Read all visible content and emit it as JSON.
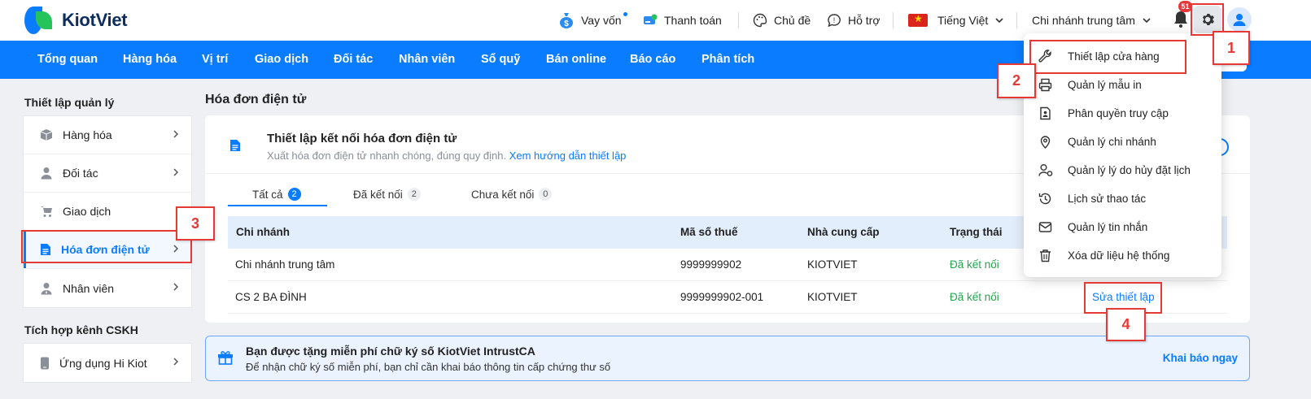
{
  "brand": {
    "name": "KiotViet"
  },
  "topbar": {
    "loan": "Vay vốn",
    "payment": "Thanh toán",
    "theme": "Chủ đề",
    "support": "Hỗ trợ",
    "language": "Tiếng Việt",
    "branch": "Chi nhánh trung tâm",
    "notification_count": "51"
  },
  "nav": [
    "Tổng quan",
    "Hàng hóa",
    "Vị trí",
    "Giao dịch",
    "Đối tác",
    "Nhân viên",
    "Sổ quỹ",
    "Bán online",
    "Báo cáo",
    "Phân tích"
  ],
  "sidebar": {
    "section1_title": "Thiết lập quản lý",
    "items": [
      {
        "label": "Hàng hóa"
      },
      {
        "label": "Đối tác"
      },
      {
        "label": "Giao dịch"
      },
      {
        "label": "Hóa đơn điện tử"
      },
      {
        "label": "Nhân viên"
      }
    ],
    "section2_title": "Tích hợp kênh CSKH",
    "items2": [
      {
        "label": "Ứng dụng Hi Kiot"
      }
    ]
  },
  "main": {
    "page_title": "Hóa đơn điện tử",
    "connect_title": "Thiết lập kết nối hóa đơn điện tử",
    "connect_desc": "Xuất hóa đơn điện tử nhanh chóng, đúng quy định.",
    "connect_link": "Xem hướng dẫn thiết lập",
    "tabs": [
      {
        "label": "Tất cả",
        "count": "2"
      },
      {
        "label": "Đã kết nối",
        "count": "2"
      },
      {
        "label": "Chưa kết nối",
        "count": "0"
      }
    ],
    "columns": [
      "Chi nhánh",
      "Mã số thuế",
      "Nhà cung cấp",
      "Trạng thái"
    ],
    "rows": [
      {
        "branch": "Chi nhánh trung tâm",
        "tax": "9999999902",
        "provider": "KIOTVIET",
        "status": "Đã kết nối",
        "action": ""
      },
      {
        "branch": "CS 2 BA ĐÌNH",
        "tax": "9999999902-001",
        "provider": "KIOTVIET",
        "status": "Đã kết nối",
        "action": "Sửa thiết lập"
      }
    ]
  },
  "promo": {
    "title": "Bạn được tặng miễn phí chữ ký số KiotViet IntrustCA",
    "subtitle": "Để nhận chữ ký số miễn phí, bạn chỉ cần khai báo thông tin cấp chứng thư số",
    "button": "Khai báo ngay"
  },
  "settings_menu": {
    "items": [
      {
        "label": "Thiết lập cửa hàng",
        "icon": "wrench-icon"
      },
      {
        "label": "Quản lý mẫu in",
        "icon": "printer-icon"
      },
      {
        "label": "Phân quyền truy cập",
        "icon": "user-doc-icon"
      },
      {
        "label": "Quản lý chi nhánh",
        "icon": "location-pin-icon"
      },
      {
        "label": "Quản lý lý do hủy đặt lịch",
        "icon": "user-gear-icon"
      },
      {
        "label": "Lịch sử thao tác",
        "icon": "history-icon"
      },
      {
        "label": "Quản lý tin nhắn",
        "icon": "mail-icon"
      },
      {
        "label": "Xóa dữ liệu hệ thống",
        "icon": "trash-icon"
      }
    ]
  },
  "annotations": {
    "n1": "1",
    "n2": "2",
    "n3": "3",
    "n4": "4"
  },
  "colors": {
    "primary": "#0a7cff",
    "success": "#1faa4b",
    "annotation": "#e53935"
  }
}
